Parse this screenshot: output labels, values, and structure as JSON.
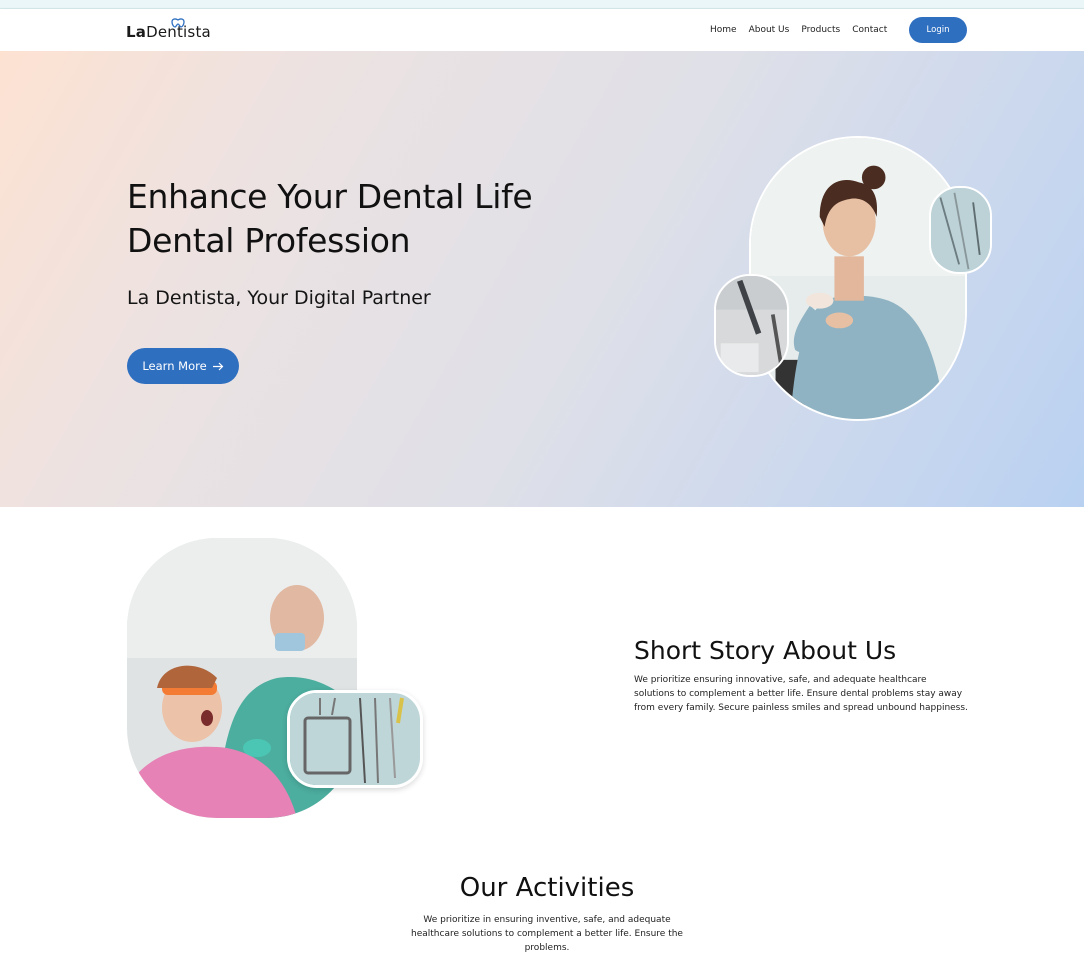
{
  "brand": {
    "prefix": "La",
    "name": "Dentista"
  },
  "nav": {
    "links": [
      "Home",
      "About Us",
      "Products",
      "Contact"
    ],
    "login_label": "Login"
  },
  "hero": {
    "title_line1": "Enhance Your Dental Life",
    "title_line2": "Dental Profession",
    "subtitle": "La Dentista, Your Digital Partner",
    "cta_label": "Learn More",
    "cta_icon": "arrow-right-icon"
  },
  "about": {
    "title": "Short Story About Us",
    "text": "We prioritize ensuring innovative, safe, and adequate healthcare solutions to complement a better life. Ensure dental problems stay away from every family. Secure painless smiles and spread unbound happiness."
  },
  "activities": {
    "title": "Our Activities",
    "text": "We prioritize in ensuring inventive, safe, and adequate healthcare solutions to complement a better life. Ensure the problems."
  },
  "colors": {
    "accent": "#2f6fc0",
    "hero_gradient_start": "#fde2d2",
    "hero_gradient_end": "#b9d1f1"
  }
}
